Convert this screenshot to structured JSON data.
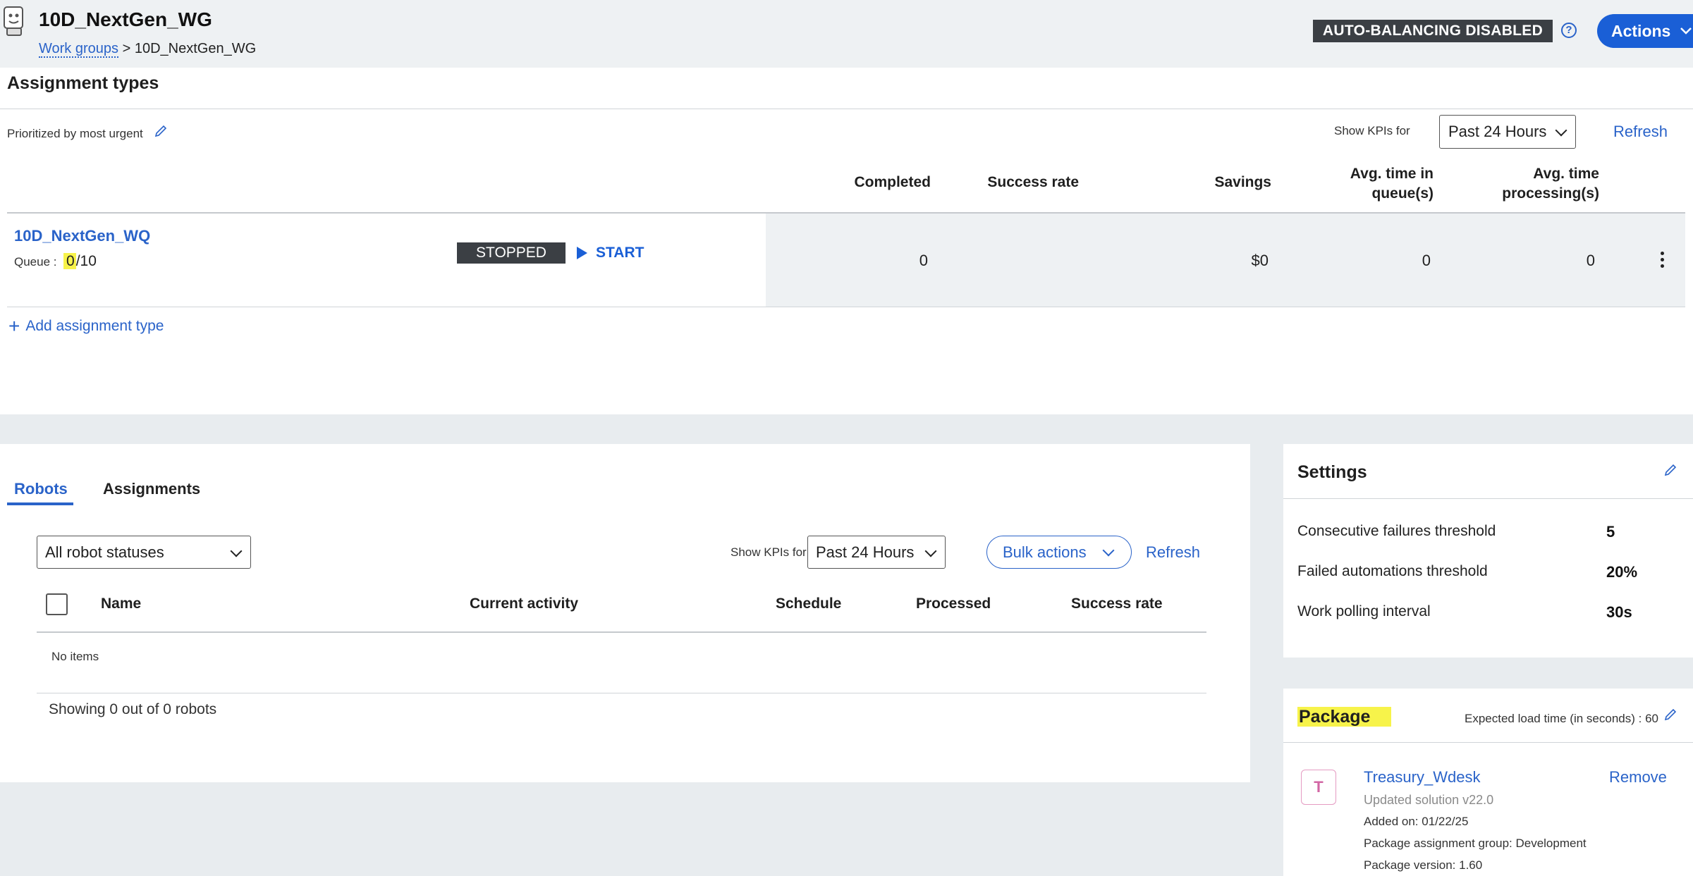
{
  "header": {
    "title": "10D_NextGen_WG",
    "breadcrumb": {
      "link": "Work groups",
      "separator": ">",
      "current": "10D_NextGen_WG"
    },
    "autobalancing_badge": "AUTO-BALANCING DISABLED",
    "help_glyph": "?",
    "actions_label": "Actions"
  },
  "assignment_types": {
    "title": "Assignment types",
    "prioritized_label": "Prioritized by most urgent",
    "kpi_label": "Show KPIs for",
    "kpi_selected": "Past 24 Hours",
    "refresh_label": "Refresh",
    "columns": {
      "completed": "Completed",
      "success_rate": "Success rate",
      "savings": "Savings",
      "avg_queue_l1": "Avg. time in",
      "avg_queue_l2": "queue(s)",
      "avg_proc_l1": "Avg. time",
      "avg_proc_l2": "processing(s)"
    },
    "row": {
      "name": "10D_NextGen_WQ",
      "queue_label": "Queue :",
      "queue_current": "0",
      "queue_total": "/10",
      "status": "STOPPED",
      "start_label": "START",
      "completed": "0",
      "success_rate": "",
      "savings": "$0",
      "avg_queue": "0",
      "avg_processing": "0"
    },
    "add_label": "Add assignment type"
  },
  "robots": {
    "tabs": [
      "Robots",
      "Assignments"
    ],
    "status_selected": "All robot statuses",
    "kpi_label": "Show KPIs for",
    "kpi_selected": "Past 24 Hours",
    "bulk_actions_label": "Bulk actions",
    "refresh_label": "Refresh",
    "columns": [
      "Name",
      "Current activity",
      "Schedule",
      "Processed",
      "Success rate"
    ],
    "empty_text": "No items",
    "footer": "Showing 0 out of 0 robots"
  },
  "settings": {
    "title": "Settings",
    "items": [
      {
        "label": "Consecutive failures threshold",
        "value": "5"
      },
      {
        "label": "Failed automations threshold",
        "value": "20%"
      },
      {
        "label": "Work polling interval",
        "value": "30s"
      }
    ]
  },
  "package": {
    "title": "Package",
    "load_time": "Expected load time (in seconds) : 60",
    "avatar_letter": "T",
    "name": "Treasury_Wdesk",
    "remove_label": "Remove",
    "updated": "Updated solution v22.0",
    "added": "Added on: 01/22/25",
    "group": "Package assignment group: Development",
    "version": "Package version: 1.60"
  },
  "colors": {
    "accent": "#2a63c9",
    "primary_button": "#1a5fd6",
    "badge_dark": "#3b3f44",
    "highlight": "#f7f34a",
    "avatar_pink": "#d266a4"
  },
  "icons": {
    "app": "robot-icon",
    "help": "help-circle-icon",
    "edit": "pencil-icon",
    "dropdown": "chevron-down-icon",
    "play": "play-icon",
    "more": "more-vertical-icon",
    "add": "plus-icon"
  }
}
